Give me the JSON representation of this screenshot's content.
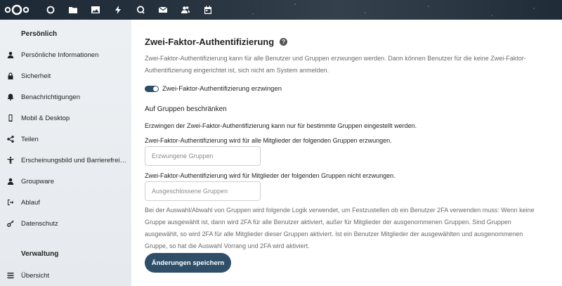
{
  "header": {
    "logo": "nextcloud-logo",
    "app_icons": [
      "dashboard-icon",
      "files-icon",
      "photos-icon",
      "activity-icon",
      "search-icon",
      "mail-icon",
      "contacts-icon",
      "calendar-icon"
    ]
  },
  "sidebar": {
    "personal_title": "Persönlich",
    "personal_items": [
      {
        "label": "Persönliche Informationen",
        "icon": "user-icon"
      },
      {
        "label": "Sicherheit",
        "icon": "lock-icon"
      },
      {
        "label": "Benachrichtigungen",
        "icon": "bell-icon"
      },
      {
        "label": "Mobil & Desktop",
        "icon": "phone-icon"
      },
      {
        "label": "Teilen",
        "icon": "share-icon"
      },
      {
        "label": "Erscheinungsbild und Barrierefreiheit",
        "icon": "accessibility-icon"
      },
      {
        "label": "Groupware",
        "icon": "groupware-icon"
      },
      {
        "label": "Ablauf",
        "icon": "flow-icon"
      },
      {
        "label": "Datenschutz",
        "icon": "key-icon"
      }
    ],
    "admin_title": "Verwaltung",
    "admin_items": [
      {
        "label": "Übersicht",
        "icon": "list-icon"
      }
    ]
  },
  "main": {
    "title": "Zwei-Faktor-Authentifizierung",
    "help": "?",
    "description": "Zwei-Faktor-Authentifizierung kann für alle Benutzer und Gruppen erzwungen werden. Dann können Benutzer für die keine Zwei-Faktor-Authentifizierung eingerichtet ist, sich nicht am System anmelden.",
    "toggle_label": "Zwei-Faktor-Authentifizierung erzwingen",
    "toggle_on": true,
    "restrict_heading": "Auf Gruppen beschränken",
    "restrict_text": "Erzwingen der Zwei-Faktor-Authentifizierung kann nur für bestimmte Gruppen eingestellt werden.",
    "enforced_label": "Zwei-Faktor-Authentifizierung wird für alle Mitglieder der folgenden Gruppen erzwungen.",
    "enforced_placeholder": "Erzwungene Gruppen",
    "excluded_label": "Zwei-Faktor-Authentifizierung wird für Mitglieder der folgenden Gruppen nicht erzwungen.",
    "excluded_placeholder": "Ausgeschlossene Gruppen",
    "logic_text": "Bei der Auswahl/Abwahl von Gruppen wird folgende Logik verwendet, um Festzustellen ob ein Benutzer 2FA verwenden muss: Wenn keine Gruppe ausgewählt ist, dann wird 2FA für alle Benutzer aktiviert, außer für Mitglieder der ausgenommenen Gruppen. Sind Gruppen ausgewählt, so wird 2FA für alle Mitglieder dieser Gruppen aktiviert. Ist ein Benutzer Mitglieder der ausgewählten und ausgenommenen Gruppe, so hat die Auswahl Vorrang und 2FA wird aktiviert.",
    "save_label": "Änderungen speichern"
  },
  "colors": {
    "accent": "#2f4f68",
    "sidebar_bg": "#eceff2"
  }
}
